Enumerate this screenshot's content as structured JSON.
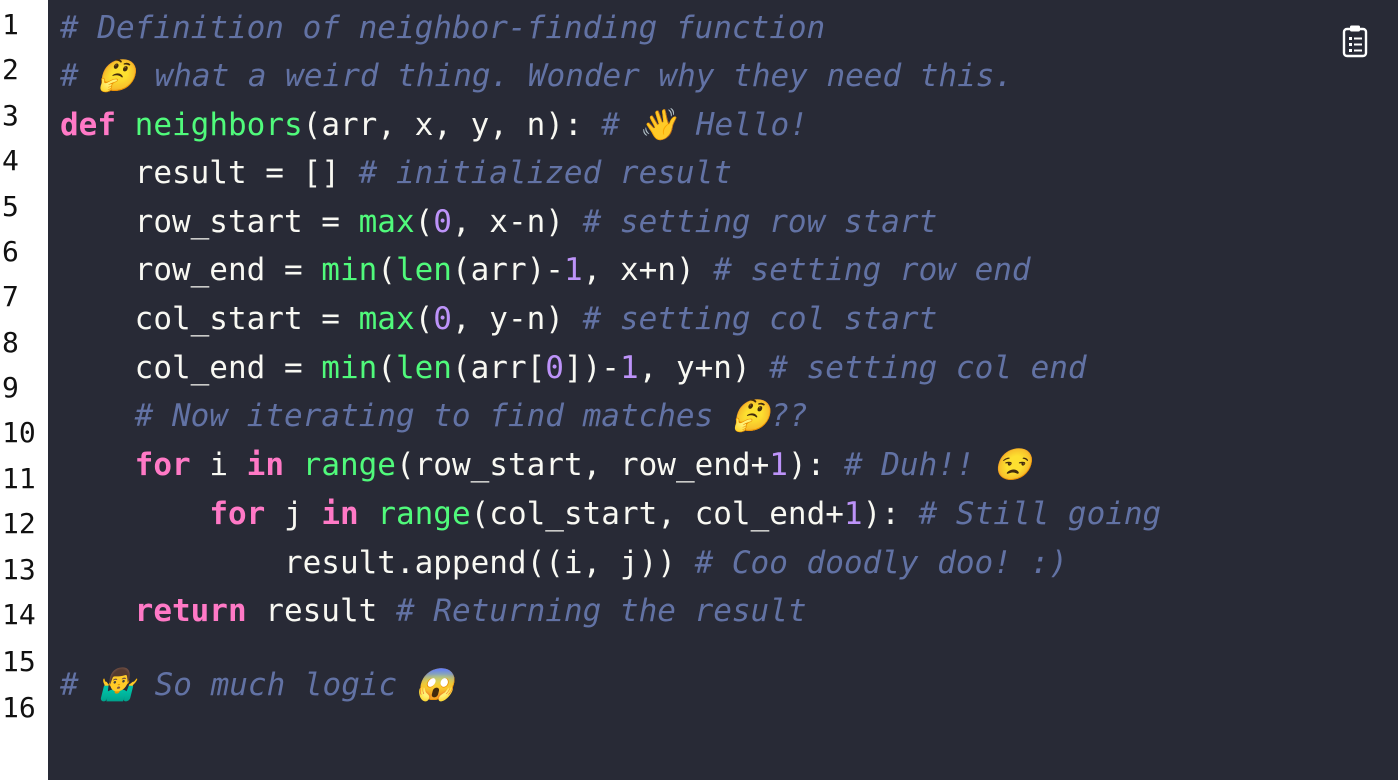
{
  "gutter": {
    "line_numbers": [
      "1",
      "2",
      "3",
      "4",
      "5",
      "6",
      "7",
      "8",
      "9",
      "10",
      "11",
      "12",
      "13",
      "14",
      "15",
      "16"
    ]
  },
  "code_lines": [
    [
      {
        "t": "# Definition of neighbor-finding function",
        "c": "comment"
      }
    ],
    [
      {
        "t": "# 🤔 what a weird thing. Wonder why they need this.",
        "c": "comment"
      }
    ],
    [
      {
        "t": "def",
        "c": "keyword"
      },
      {
        "t": " ",
        "c": "plain"
      },
      {
        "t": "neighbors",
        "c": "function"
      },
      {
        "t": "(arr, x, y, n): ",
        "c": "plain"
      },
      {
        "t": "# 👋 Hello!",
        "c": "comment"
      }
    ],
    [
      {
        "t": "    result = [] ",
        "c": "plain"
      },
      {
        "t": "# initialized result",
        "c": "comment"
      }
    ],
    [
      {
        "t": "    row_start = ",
        "c": "plain"
      },
      {
        "t": "max",
        "c": "function"
      },
      {
        "t": "(",
        "c": "plain"
      },
      {
        "t": "0",
        "c": "number"
      },
      {
        "t": ", x-n) ",
        "c": "plain"
      },
      {
        "t": "# setting row start",
        "c": "comment"
      }
    ],
    [
      {
        "t": "    row_end = ",
        "c": "plain"
      },
      {
        "t": "min",
        "c": "function"
      },
      {
        "t": "(",
        "c": "plain"
      },
      {
        "t": "len",
        "c": "function"
      },
      {
        "t": "(arr)-",
        "c": "plain"
      },
      {
        "t": "1",
        "c": "number"
      },
      {
        "t": ", x+n) ",
        "c": "plain"
      },
      {
        "t": "# setting row end",
        "c": "comment"
      }
    ],
    [
      {
        "t": "    col_start = ",
        "c": "plain"
      },
      {
        "t": "max",
        "c": "function"
      },
      {
        "t": "(",
        "c": "plain"
      },
      {
        "t": "0",
        "c": "number"
      },
      {
        "t": ", y-n) ",
        "c": "plain"
      },
      {
        "t": "# setting col start",
        "c": "comment"
      }
    ],
    [
      {
        "t": "    col_end = ",
        "c": "plain"
      },
      {
        "t": "min",
        "c": "function"
      },
      {
        "t": "(",
        "c": "plain"
      },
      {
        "t": "len",
        "c": "function"
      },
      {
        "t": "(arr[",
        "c": "plain"
      },
      {
        "t": "0",
        "c": "number"
      },
      {
        "t": "])-",
        "c": "plain"
      },
      {
        "t": "1",
        "c": "number"
      },
      {
        "t": ", y+n) ",
        "c": "plain"
      },
      {
        "t": "# setting col end",
        "c": "comment"
      }
    ],
    [
      {
        "t": "    ",
        "c": "plain"
      },
      {
        "t": "# Now iterating to find matches 🤔??",
        "c": "comment"
      }
    ],
    [
      {
        "t": "    ",
        "c": "plain"
      },
      {
        "t": "for",
        "c": "keyword"
      },
      {
        "t": " i ",
        "c": "plain"
      },
      {
        "t": "in",
        "c": "keyword"
      },
      {
        "t": " ",
        "c": "plain"
      },
      {
        "t": "range",
        "c": "function"
      },
      {
        "t": "(row_start, row_end+",
        "c": "plain"
      },
      {
        "t": "1",
        "c": "number"
      },
      {
        "t": "): ",
        "c": "plain"
      },
      {
        "t": "# Duh!! 😒",
        "c": "comment"
      }
    ],
    [
      {
        "t": "        ",
        "c": "plain"
      },
      {
        "t": "for",
        "c": "keyword"
      },
      {
        "t": " j ",
        "c": "plain"
      },
      {
        "t": "in",
        "c": "keyword"
      },
      {
        "t": " ",
        "c": "plain"
      },
      {
        "t": "range",
        "c": "function"
      },
      {
        "t": "(col_start, col_end+",
        "c": "plain"
      },
      {
        "t": "1",
        "c": "number"
      },
      {
        "t": "): ",
        "c": "plain"
      },
      {
        "t": "# Still going",
        "c": "comment"
      }
    ],
    [
      {
        "t": "            result.append((i, j)) ",
        "c": "plain"
      },
      {
        "t": "# Coo doodly doo! :)",
        "c": "comment"
      }
    ],
    [
      {
        "t": "    ",
        "c": "plain"
      },
      {
        "t": "return",
        "c": "keyword"
      },
      {
        "t": " result ",
        "c": "plain"
      },
      {
        "t": "# Returning the result",
        "c": "comment"
      }
    ],
    [],
    [
      {
        "t": "# 🤷‍♂️ So much logic 😱",
        "c": "comment"
      }
    ]
  ],
  "colors": {
    "background": "#282a36",
    "plain": "#f8f8f2",
    "comment": "#6272a4",
    "keyword": "#ff79c6",
    "function": "#50fa7b",
    "number": "#bd93f9",
    "gutter_background": "#ffffff",
    "gutter_text": "#111111"
  },
  "toolbar": {
    "copy_icon": "clipboard-icon"
  }
}
